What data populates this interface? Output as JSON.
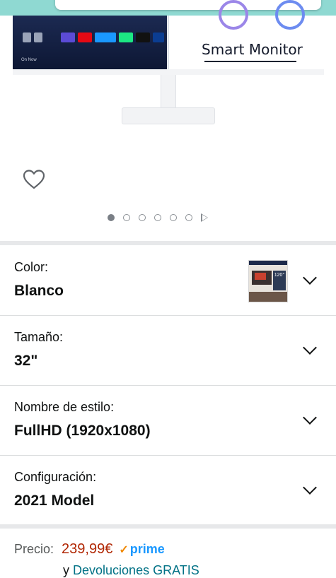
{
  "hero": {
    "screen_title": "Smart Monitor",
    "screen_now_label": "On Now",
    "pager_count": 6,
    "pager_active": 0
  },
  "variants": [
    {
      "label": "Color:",
      "value": "Blanco",
      "has_thumbnail": true
    },
    {
      "label": "Tamaño:",
      "value": "32\""
    },
    {
      "label": "Nombre de estilo:",
      "value": "FullHD (1920x1080)"
    },
    {
      "label": "Configuración:",
      "value": "2021 Model"
    }
  ],
  "thumbnail_text": "120°",
  "price": {
    "label": "Precio:",
    "amount": "239,99€",
    "prime_check": "✓",
    "prime_label": "prime",
    "returns_prefix": "y",
    "returns_link": "Devoluciones GRATIS"
  },
  "colors": {
    "price": "#b12704",
    "prime": "#1a98ff",
    "link": "#007185",
    "search_strip": "#8fd9d2"
  },
  "icons": [
    "heart-icon",
    "chevron-down-icon",
    "play-next-icon"
  ]
}
